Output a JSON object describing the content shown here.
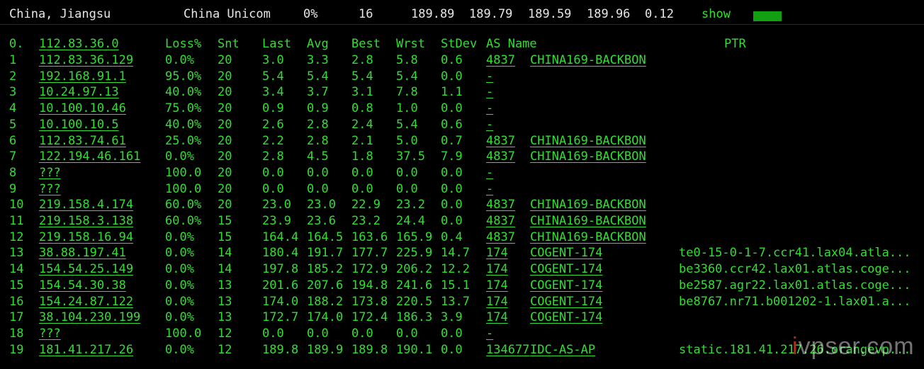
{
  "summary": {
    "location": "China, Jiangsu",
    "isp": "China Unicom",
    "loss": "0%",
    "sent": "16",
    "last": "189.89",
    "avg": "189.79",
    "best": "189.59",
    "worst": "189.96",
    "stdev": "0.12",
    "show_label": "show"
  },
  "headers": {
    "hop": "0.",
    "host": "112.83.36.0",
    "loss": "Loss%",
    "snt": "Snt",
    "last": "Last",
    "avg": "Avg",
    "best": "Best",
    "wrst": "Wrst",
    "stdev": "StDev",
    "asname": "AS Name",
    "ptr": "PTR"
  },
  "rows": [
    {
      "hop": "1",
      "host": "112.83.36.129",
      "loss": "0.0%",
      "snt": "20",
      "last": "3.0",
      "avg": "3.3",
      "best": "2.8",
      "wrst": "5.8",
      "stdev": "0.6",
      "asn": "4837",
      "asname": "CHINA169-BACKBON",
      "ptr": ""
    },
    {
      "hop": "2",
      "host": "192.168.91.1",
      "loss": "95.0%",
      "snt": "20",
      "last": "5.4",
      "avg": "5.4",
      "best": "5.4",
      "wrst": "5.4",
      "stdev": "0.0",
      "asn": "-",
      "asname": "",
      "ptr": ""
    },
    {
      "hop": "3",
      "host": "10.24.97.13",
      "loss": "40.0%",
      "snt": "20",
      "last": "3.4",
      "avg": "3.7",
      "best": "3.1",
      "wrst": "7.8",
      "stdev": "1.1",
      "asn": "-",
      "asname": "",
      "ptr": ""
    },
    {
      "hop": "4",
      "host": "10.100.10.46",
      "loss": "75.0%",
      "snt": "20",
      "last": "0.9",
      "avg": "0.9",
      "best": "0.8",
      "wrst": "1.0",
      "stdev": "0.0",
      "asn": "-",
      "asname": "",
      "ptr": ""
    },
    {
      "hop": "5",
      "host": "10.100.10.5",
      "loss": "40.0%",
      "snt": "20",
      "last": "2.6",
      "avg": "2.8",
      "best": "2.4",
      "wrst": "5.4",
      "stdev": "0.6",
      "asn": "-",
      "asname": "",
      "ptr": ""
    },
    {
      "hop": "6",
      "host": "112.83.74.61",
      "loss": "25.0%",
      "snt": "20",
      "last": "2.2",
      "avg": "2.8",
      "best": "2.1",
      "wrst": "5.0",
      "stdev": "0.7",
      "asn": "4837",
      "asname": "CHINA169-BACKBON",
      "ptr": ""
    },
    {
      "hop": "7",
      "host": "122.194.46.161",
      "loss": "0.0%",
      "snt": "20",
      "last": "2.8",
      "avg": "4.5",
      "best": "1.8",
      "wrst": "37.5",
      "stdev": "7.9",
      "asn": "4837",
      "asname": "CHINA169-BACKBON",
      "ptr": ""
    },
    {
      "hop": "8",
      "host": "???",
      "loss": "100.0",
      "snt": "20",
      "last": "0.0",
      "avg": "0.0",
      "best": "0.0",
      "wrst": "0.0",
      "stdev": "0.0",
      "asn": "-",
      "asname": "",
      "ptr": ""
    },
    {
      "hop": "9",
      "host": "???",
      "loss": "100.0",
      "snt": "20",
      "last": "0.0",
      "avg": "0.0",
      "best": "0.0",
      "wrst": "0.0",
      "stdev": "0.0",
      "asn": "-",
      "asname": "",
      "ptr": ""
    },
    {
      "hop": "10",
      "host": "219.158.4.174",
      "loss": "60.0%",
      "snt": "20",
      "last": "23.0",
      "avg": "23.0",
      "best": "22.9",
      "wrst": "23.2",
      "stdev": "0.0",
      "asn": "4837",
      "asname": "CHINA169-BACKBON",
      "ptr": ""
    },
    {
      "hop": "11",
      "host": "219.158.3.138",
      "loss": "60.0%",
      "snt": "15",
      "last": "23.9",
      "avg": "23.6",
      "best": "23.2",
      "wrst": "24.4",
      "stdev": "0.0",
      "asn": "4837",
      "asname": "CHINA169-BACKBON",
      "ptr": ""
    },
    {
      "hop": "12",
      "host": "219.158.16.94",
      "loss": "0.0%",
      "snt": "15",
      "last": "164.4",
      "avg": "164.5",
      "best": "163.6",
      "wrst": "165.9",
      "stdev": "0.4",
      "asn": "4837",
      "asname": "CHINA169-BACKBON",
      "ptr": ""
    },
    {
      "hop": "13",
      "host": "38.88.197.41",
      "loss": "0.0%",
      "snt": "14",
      "last": "180.4",
      "avg": "191.7",
      "best": "177.7",
      "wrst": "225.9",
      "stdev": "14.7",
      "asn": "174",
      "asname": "COGENT-174",
      "ptr": "te0-15-0-1-7.ccr41.lax04.atla..."
    },
    {
      "hop": "14",
      "host": "154.54.25.149",
      "loss": "0.0%",
      "snt": "14",
      "last": "197.8",
      "avg": "185.2",
      "best": "172.9",
      "wrst": "206.2",
      "stdev": "12.2",
      "asn": "174",
      "asname": "COGENT-174",
      "ptr": "be3360.ccr42.lax01.atlas.coge..."
    },
    {
      "hop": "15",
      "host": "154.54.30.38",
      "loss": "0.0%",
      "snt": "13",
      "last": "201.6",
      "avg": "207.6",
      "best": "194.8",
      "wrst": "241.6",
      "stdev": "15.1",
      "asn": "174",
      "asname": "COGENT-174",
      "ptr": "be2587.agr22.lax01.atlas.coge..."
    },
    {
      "hop": "16",
      "host": "154.24.87.122",
      "loss": "0.0%",
      "snt": "13",
      "last": "174.0",
      "avg": "188.2",
      "best": "173.8",
      "wrst": "220.5",
      "stdev": "13.7",
      "asn": "174",
      "asname": "COGENT-174",
      "ptr": "be8767.nr71.b001202-1.lax01.a..."
    },
    {
      "hop": "17",
      "host": "38.104.230.199",
      "loss": "0.0%",
      "snt": "13",
      "last": "172.7",
      "avg": "174.0",
      "best": "172.4",
      "wrst": "186.3",
      "stdev": "3.9",
      "asn": "174",
      "asname": "COGENT-174",
      "ptr": ""
    },
    {
      "hop": "18",
      "host": "???",
      "loss": "100.0",
      "snt": "12",
      "last": "0.0",
      "avg": "0.0",
      "best": "0.0",
      "wrst": "0.0",
      "stdev": "0.0",
      "asn": "-",
      "asname": "",
      "ptr": ""
    },
    {
      "hop": "19",
      "host": "181.41.217.26",
      "loss": "0.0%",
      "snt": "12",
      "last": "189.8",
      "avg": "189.9",
      "best": "189.8",
      "wrst": "190.1",
      "stdev": "0.0",
      "asn": "134677",
      "asname": "IDC-AS-AP",
      "ptr": "static.181.41.217.26.orangevp..."
    }
  ],
  "watermark": {
    "prefix": "i",
    "main": "vps",
    "suffix": "er.com"
  }
}
